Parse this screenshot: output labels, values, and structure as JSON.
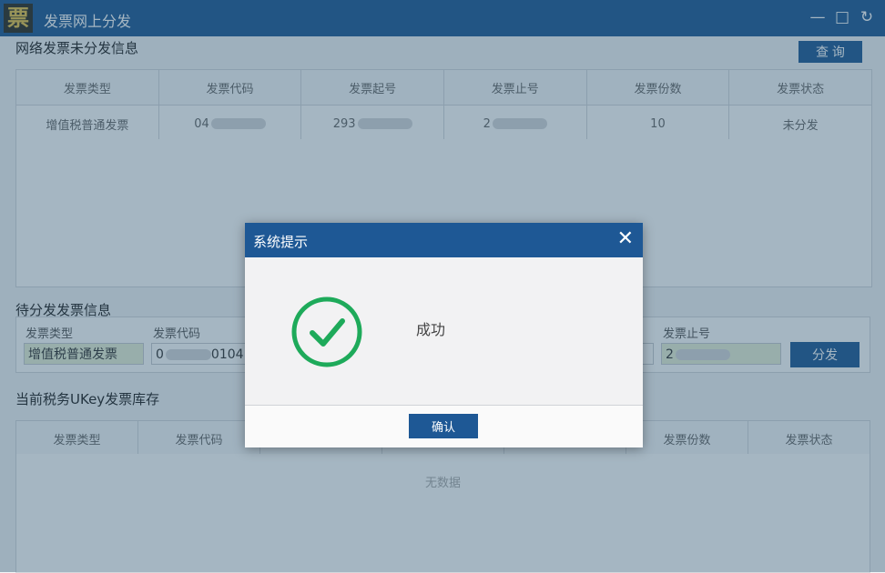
{
  "window": {
    "title": "发票网上分发",
    "logo_char": "票",
    "minimize_glyph": "—",
    "maximize_glyph": "□",
    "restore_glyph": "↻"
  },
  "network_section": {
    "title": "网络发票未分发信息",
    "query_label": "查 询",
    "columns": [
      "发票类型",
      "发票代码",
      "发票起号",
      "发票止号",
      "发票份数",
      "发票状态"
    ],
    "rows": [
      {
        "type": "增值税普通发票",
        "code": "04",
        "start": "293",
        "end": "2",
        "count": "10",
        "status": "未分发"
      }
    ]
  },
  "pending_section": {
    "title": "待分发发票信息",
    "type_label": "发票类型",
    "type_value": "增值税普通发票",
    "code_label": "发票代码",
    "code_value": "0",
    "code_suffix": "0104",
    "end_label": "发票止号",
    "end_value": "2",
    "distribute_label": "分发"
  },
  "stock_section": {
    "title": "当前税务UKey发票库存",
    "columns": [
      "发票类型",
      "发票代码",
      "",
      "",
      "",
      "发票份数",
      "发票状态"
    ],
    "empty_text": "无数据"
  },
  "dialog": {
    "title": "系统提示",
    "close_glyph": "✕",
    "message": "成功",
    "confirm_label": "确认",
    "success_color": "#1eaa5a"
  },
  "colors": {
    "brand": "#1e5895"
  }
}
